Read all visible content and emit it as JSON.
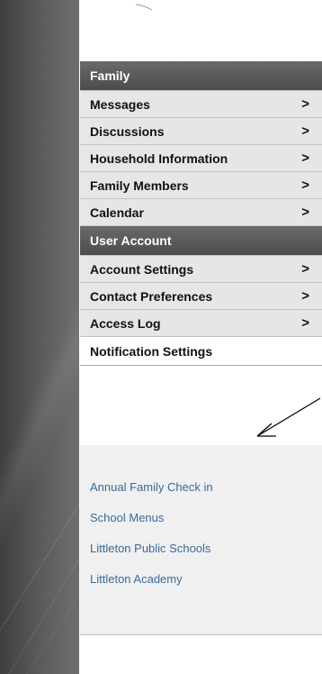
{
  "sections": [
    {
      "header": "Family",
      "items": [
        {
          "label": "Messages",
          "chevron": ">"
        },
        {
          "label": "Discussions",
          "chevron": ">"
        },
        {
          "label": "Household Information",
          "chevron": ">"
        },
        {
          "label": "Family Members",
          "chevron": ">"
        },
        {
          "label": "Calendar",
          "chevron": ">"
        }
      ]
    },
    {
      "header": "User Account",
      "items": [
        {
          "label": "Account Settings",
          "chevron": ">"
        },
        {
          "label": "Contact Preferences",
          "chevron": ">"
        },
        {
          "label": "Access Log",
          "chevron": ">"
        },
        {
          "label": "Notification Settings",
          "chevron": ""
        }
      ]
    }
  ],
  "links": [
    "Annual Family Check in",
    "School Menus",
    "Littleton Public Schools",
    "Littleton Academy"
  ],
  "colors": {
    "header_bg": "#4c4c4c",
    "item_bg": "#e6e6e6",
    "link": "#3a6a9a",
    "rail": "#5b5b5b"
  }
}
